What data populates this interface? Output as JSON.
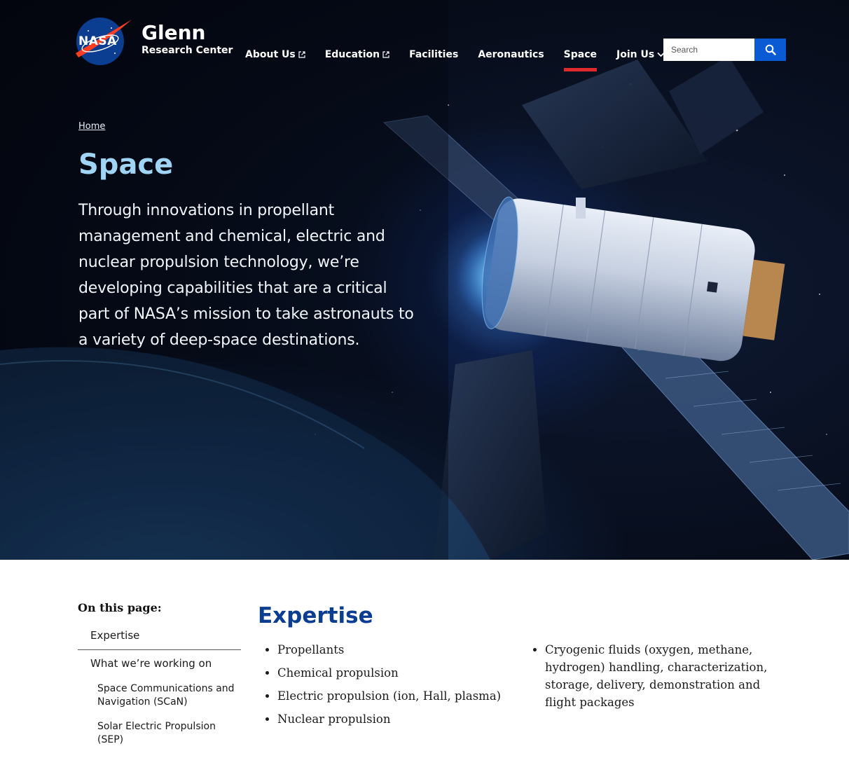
{
  "header": {
    "logo_text": "NASA",
    "site_name": "Glenn",
    "site_subtitle": "Research Center"
  },
  "nav": {
    "items": [
      {
        "label": "About Us",
        "icon": "external-link-icon"
      },
      {
        "label": "Education",
        "icon": "external-link-icon"
      },
      {
        "label": "Facilities"
      },
      {
        "label": "Aeronautics"
      },
      {
        "label": "Space",
        "active": true
      },
      {
        "label": "Join Us",
        "icon": "chevron-down-icon"
      }
    ]
  },
  "search": {
    "placeholder": "Search",
    "icon": "search-icon"
  },
  "hero": {
    "breadcrumb": "Home",
    "title": "Space",
    "intro": "Through innovations in propellant management and chemical, electric and nuclear propulsion technology, we’re developing capabilities that are a critical part of NASA’s mission to take astronauts to a variety of deep-space destinations."
  },
  "toc": {
    "title": "On this page:",
    "items": [
      {
        "label": "Expertise"
      },
      {
        "label": "What we’re working on"
      },
      {
        "label": "Space Communications and Navigation (SCaN)"
      },
      {
        "label": "Solar Electric Propulsion (SEP)"
      }
    ]
  },
  "expertise": {
    "title": "Expertise",
    "col1": [
      "Propellants",
      "Chemical propulsion",
      "Electric propulsion (ion, Hall, plasma)",
      "Nuclear propulsion"
    ],
    "col2": [
      "Cryogenic fluids (oxygen, methane, hydrogen) handling, characterization, storage, delivery, demonstration and flight packages"
    ]
  },
  "colors": {
    "accent_red": "#e0292d",
    "search_blue": "#0a5bd3",
    "title_light_blue": "#9fd4f5",
    "section_blue": "#0b3d91"
  }
}
